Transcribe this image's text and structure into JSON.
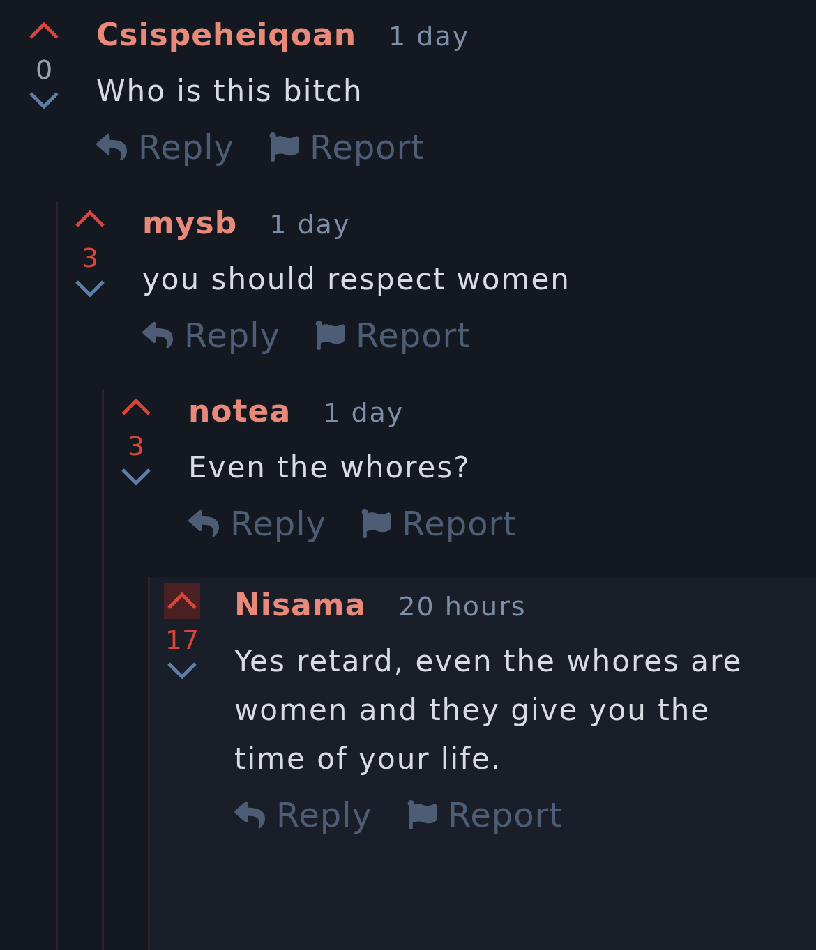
{
  "comments": [
    {
      "author": "Csispeheiqoan",
      "time": "1 day",
      "score": {
        "value": "0",
        "color": "#9aa3ad"
      },
      "upvoted": false,
      "highlighted": false,
      "body": [
        "Who is this bitch"
      ],
      "actions": [
        "Reply",
        "Report"
      ],
      "children": [
        {
          "author": "mysb",
          "time": "1 day",
          "score": {
            "value": "3",
            "color": "#d9453a"
          },
          "upvoted": false,
          "highlighted": false,
          "body": [
            "you should respect women"
          ],
          "actions": [
            "Reply",
            "Report"
          ],
          "children": [
            {
              "author": "notea",
              "time": "1 day",
              "score": {
                "value": "3",
                "color": "#d9453a"
              },
              "upvoted": false,
              "highlighted": false,
              "body": [
                "Even the whores?"
              ],
              "actions": [
                "Reply",
                "Report"
              ],
              "children": [
                {
                  "author": "Nisama",
                  "time": "20 hours",
                  "score": {
                    "value": "17",
                    "color": "#d9453a"
                  },
                  "upvoted": true,
                  "highlighted": true,
                  "body": [
                    "Yes retard, even the whores are",
                    "women and they give you the",
                    "time of your life."
                  ],
                  "actions": [
                    "Reply",
                    "Report"
                  ]
                }
              ]
            }
          ]
        }
      ]
    }
  ]
}
